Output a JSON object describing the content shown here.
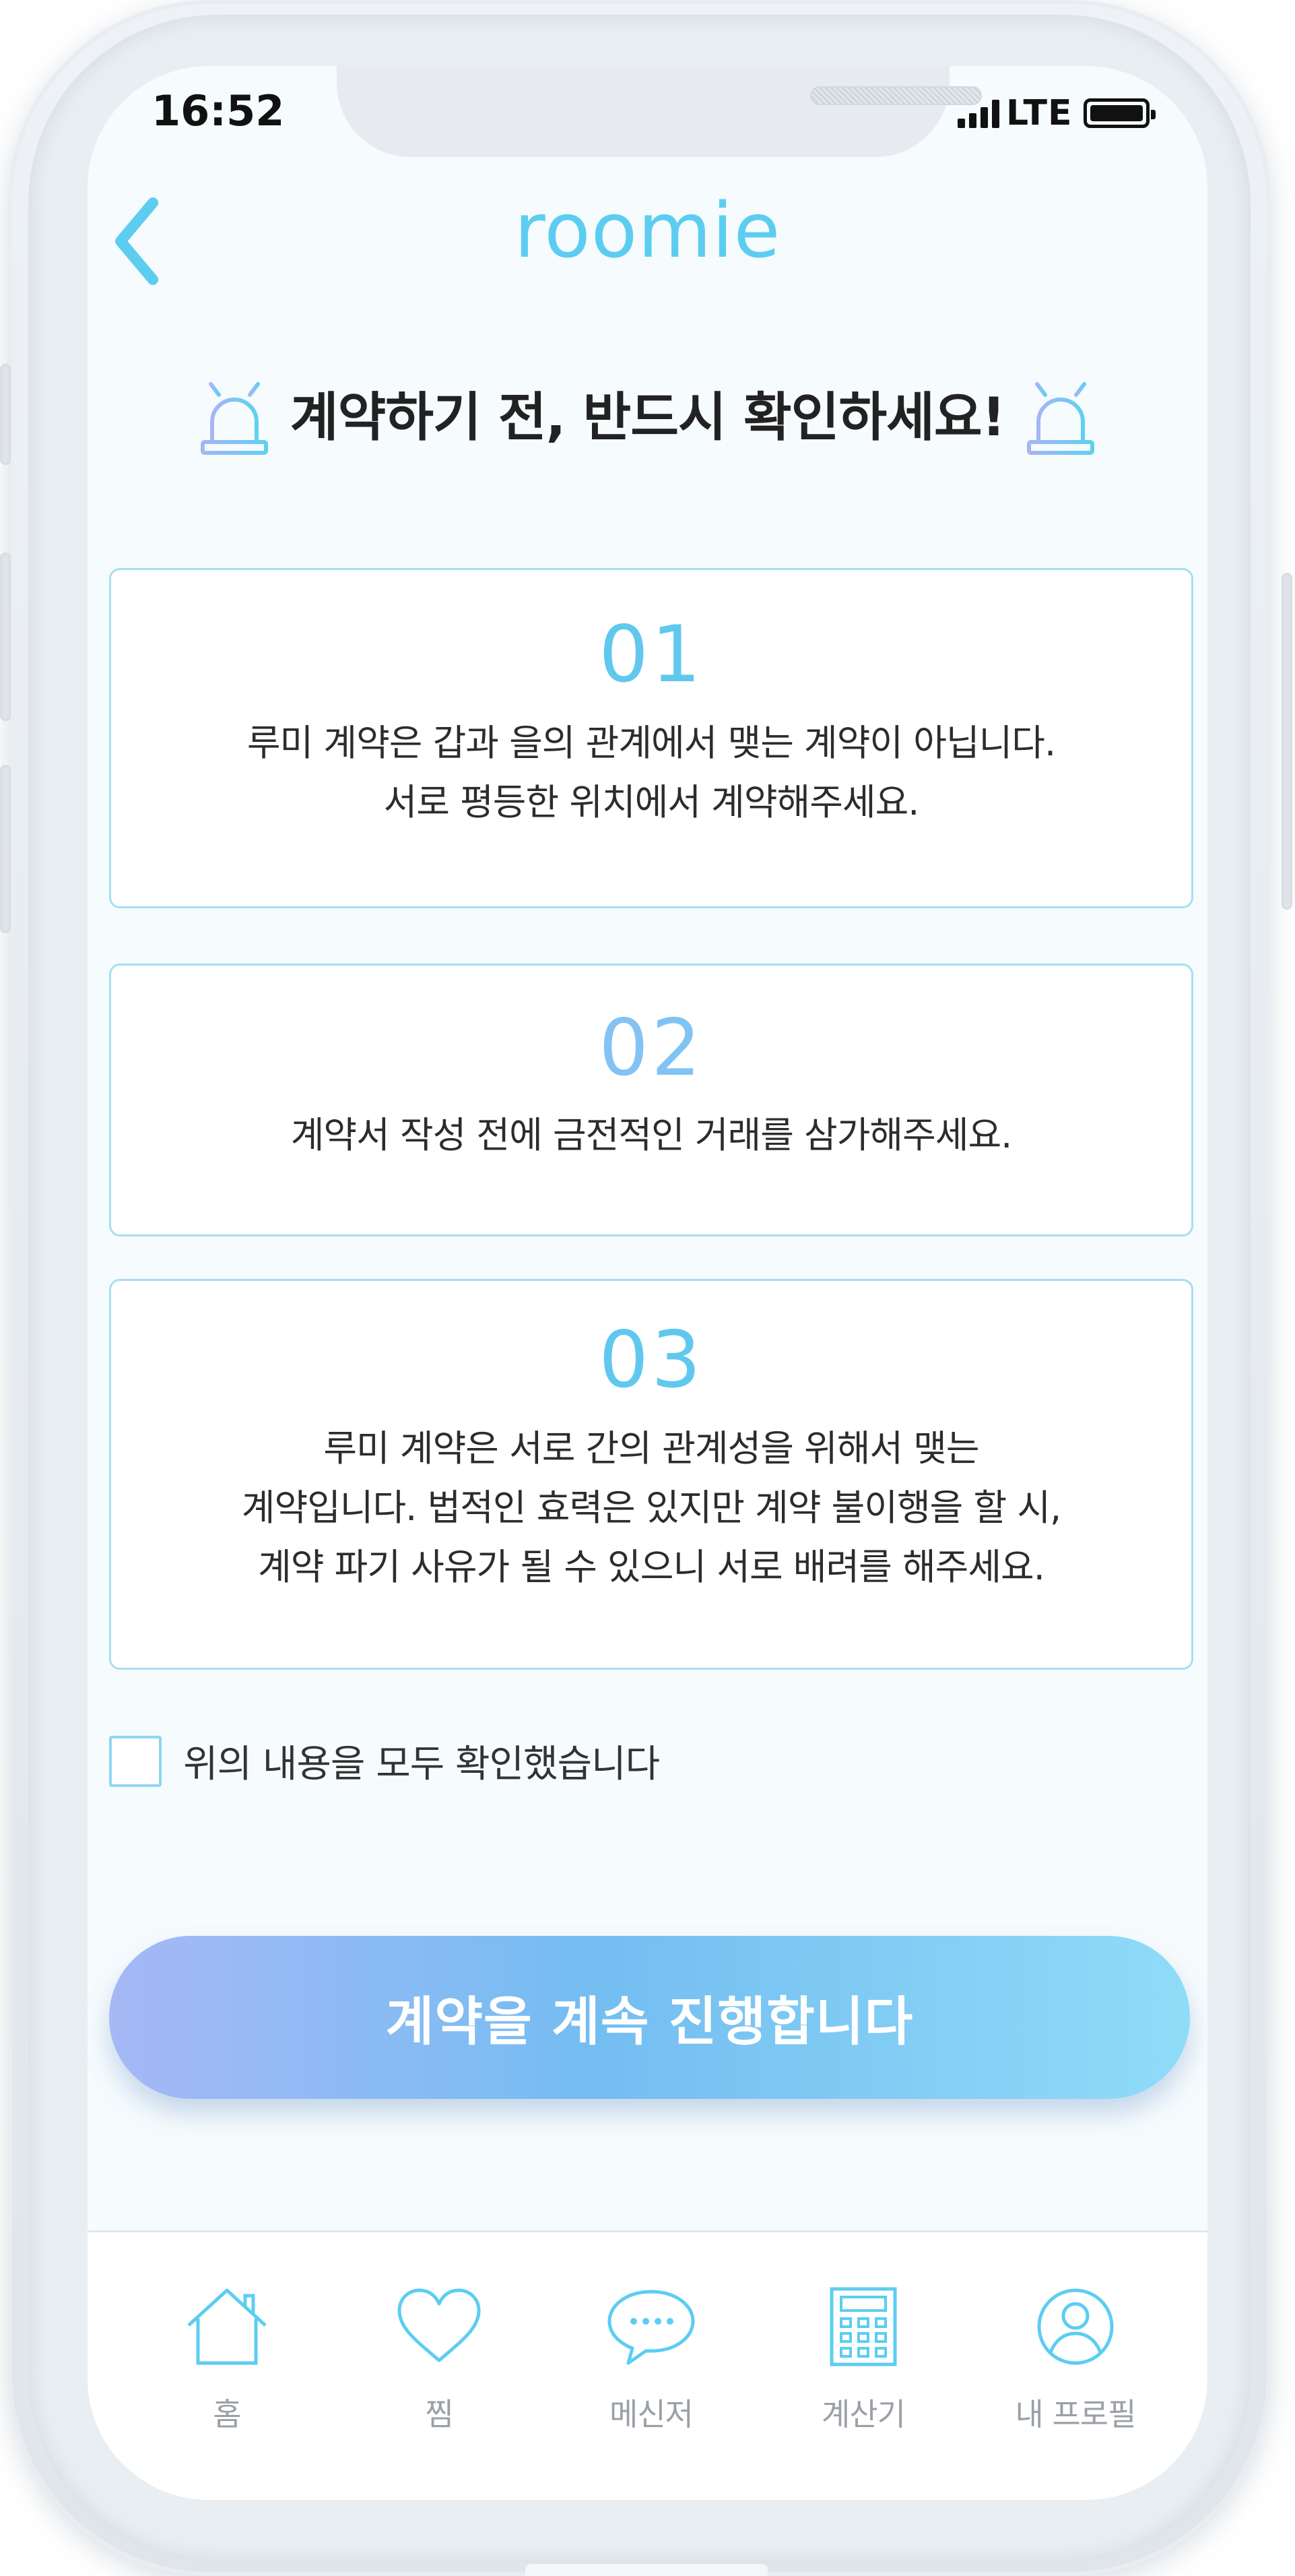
{
  "status_bar": {
    "time": "16:52",
    "network": "LTE"
  },
  "header": {
    "title": "roomie"
  },
  "warning": {
    "heading": "계약하기 전, 반드시 확인하세요!"
  },
  "cards": [
    {
      "number": "01",
      "lines": [
        "루미 계약은 갑과 을의 관계에서 맺는 계약이 아닙니다.",
        "서로 평등한 위치에서 계약해주세요."
      ]
    },
    {
      "number": "02",
      "lines": [
        "계약서 작성 전에 금전적인 거래를 삼가해주세요."
      ]
    },
    {
      "number": "03",
      "lines": [
        "루미 계약은 서로 간의 관계성을 위해서 맺는",
        "계약입니다. 법적인 효력은 있지만 계약 불이행을 할 시,",
        "계약 파기 사유가 될 수 있으니 서로 배려를 해주세요."
      ]
    }
  ],
  "agreement": {
    "label": "위의 내용을 모두 확인했습니다",
    "checked": false
  },
  "cta": {
    "label": "계약을 계속 진행합니다"
  },
  "tabbar": {
    "items": [
      {
        "label": "홈",
        "icon": "home-icon"
      },
      {
        "label": "찜",
        "icon": "heart-icon"
      },
      {
        "label": "메신저",
        "icon": "chat-bubble-icon"
      },
      {
        "label": "계산기",
        "icon": "calculator-icon"
      },
      {
        "label": "내 프로필",
        "icon": "profile-icon"
      }
    ]
  },
  "colors": {
    "accent": "#5ccdf1",
    "card_border": "#a7def1",
    "tab_icon": "#5ccdf1",
    "tab_label": "#9aa0a6"
  }
}
